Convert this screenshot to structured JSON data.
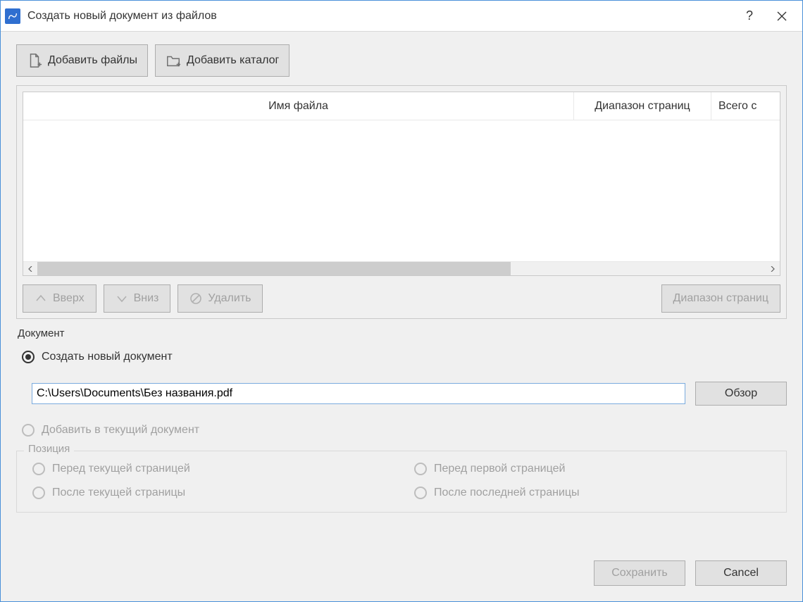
{
  "window": {
    "title": "Создать новый документ из файлов"
  },
  "toolbar": {
    "add_files": "Добавить файлы",
    "add_folder": "Добавить каталог"
  },
  "table": {
    "headers": {
      "filename": "Имя файла",
      "range": "Диапазон страниц",
      "total": "Всего с"
    }
  },
  "row_actions": {
    "up": "Вверх",
    "down": "Вниз",
    "delete": "Удалить",
    "page_range": "Диапазон страниц"
  },
  "document": {
    "section_label": "Документ",
    "create_new_label": "Создать новый документ",
    "path_value": "C:\\Users\\Documents\\Без названия.pdf",
    "browse": "Обзор",
    "add_to_current_label": "Добавить в текущий документ"
  },
  "position": {
    "legend": "Позиция",
    "before_current": "Перед текущей страницей",
    "after_current": "После текущей страницы",
    "before_first": "Перед первой страницей",
    "after_last": "После последней страницы"
  },
  "footer": {
    "save": "Сохранить",
    "cancel": "Cancel"
  }
}
